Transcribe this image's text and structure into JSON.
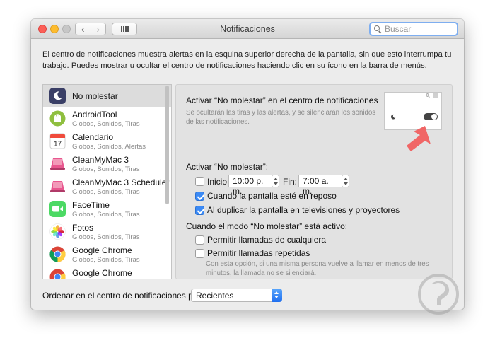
{
  "window": {
    "title": "Notificaciones",
    "search": {
      "placeholder": "Buscar",
      "value": ""
    },
    "nav": {
      "back_icon": "chevron-left-icon",
      "forward_icon": "chevron-right-icon",
      "grid_icon": "grid-icon"
    }
  },
  "description": "El centro de notificaciones muestra alertas en la esquina superior derecha de la pantalla, sin que esto interrumpa tu trabajo. Puedes mostrar u ocultar el centro de notificaciones haciendo clic en su ícono en la barra de menús.",
  "sidebar": {
    "items": [
      {
        "name": "No molestar",
        "sub": "",
        "icon": "moon-icon",
        "selected": true
      },
      {
        "name": "AndroidTool",
        "sub": "Globos, Sonidos, Tiras",
        "icon": "android-icon"
      },
      {
        "name": "Calendario",
        "sub": "Globos, Sonidos, Alertas",
        "icon": "calendar-icon",
        "calendar_day": "17"
      },
      {
        "name": "CleanMyMac 3",
        "sub": "Globos, Sonidos, Tiras",
        "icon": "cleanmymac-icon"
      },
      {
        "name": "CleanMyMac 3 Scheduler",
        "sub": "Globos, Sonidos, Tiras",
        "icon": "cleanmymac-icon"
      },
      {
        "name": "FaceTime",
        "sub": "Globos, Sonidos, Tiras",
        "icon": "facetime-icon"
      },
      {
        "name": "Fotos",
        "sub": "Globos, Sonidos, Tiras",
        "icon": "photos-icon"
      },
      {
        "name": "Google Chrome",
        "sub": "Globos, Sonidos, Tiras",
        "icon": "chrome-icon"
      },
      {
        "name": "Google Chrome",
        "sub": "",
        "icon": "chrome-icon"
      }
    ]
  },
  "panel": {
    "title": "Activar “No molestar” en el centro de notificaciones",
    "subtitle": "Se ocultarán las tiras y las alertas, y se silenciarán los sonidos de las notificaciones.",
    "activate_heading": "Activar “No molestar”:",
    "start_label": "Inicio:",
    "start_time": "10:00 p. m.",
    "end_label": "Fin:",
    "end_time": "7:00 a. m.",
    "schedule_checked": false,
    "option_sleep": {
      "label": "Cuando la pantalla esté en reposo",
      "checked": true
    },
    "option_mirror": {
      "label": "Al duplicar la pantalla en televisiones y proyectores",
      "checked": true
    },
    "active_heading": "Cuando el modo “No molestar” está activo:",
    "option_calls_anyone": {
      "label": "Permitir llamadas de cualquiera",
      "checked": false
    },
    "option_calls_repeat": {
      "label": "Permitir llamadas repetidas",
      "checked": false
    },
    "note": "Con esta opción, si una misma persona vuelve a llamar en menos de tres minutos, la llamada no se silenciará."
  },
  "footer": {
    "sort_label": "Ordenar en el centro de notificaciones por:",
    "sort_value": "Recientes"
  },
  "colors": {
    "accent": "#3b8af5",
    "arrow": "#f06666",
    "close": "#fc5f57",
    "minimize": "#fdbc2e"
  }
}
